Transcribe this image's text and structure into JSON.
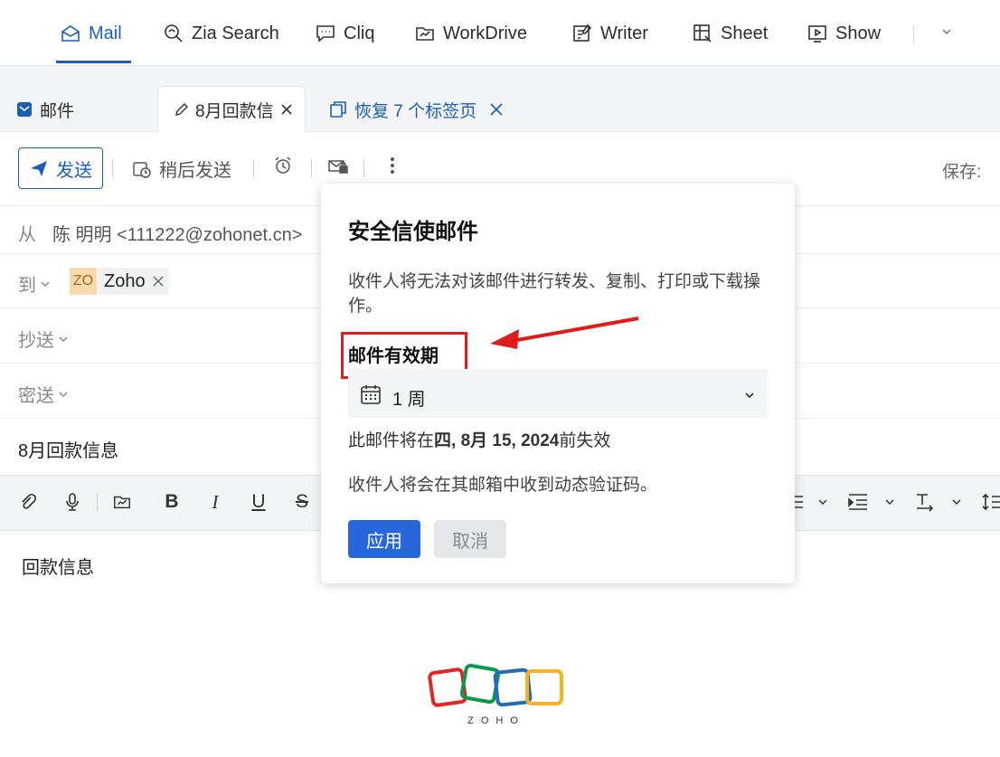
{
  "apps": [
    {
      "label": "Mail",
      "icon": "mail-icon"
    },
    {
      "label": "Zia Search",
      "icon": "zia-search-icon"
    },
    {
      "label": "Cliq",
      "icon": "chat-icon"
    },
    {
      "label": "WorkDrive",
      "icon": "folder-icon"
    },
    {
      "label": "Writer",
      "icon": "writer-icon"
    },
    {
      "label": "Sheet",
      "icon": "sheet-icon"
    },
    {
      "label": "Show",
      "icon": "show-icon"
    }
  ],
  "tabs": {
    "mail": "邮件",
    "draft": "8月回款信",
    "restore": "恢复 7 个标签页"
  },
  "toolbar": {
    "send": "发送",
    "send_later": "稍后发送",
    "save_label": "保存:"
  },
  "compose": {
    "from_label": "从",
    "from_value": "陈 明明 <111222@zohonet.cn>",
    "to_label": "到",
    "recipient_avatar": "ZO",
    "recipient_name": "Zoho",
    "cc_label": "抄送",
    "bcc_label": "密送",
    "subject": "8月回款信息",
    "body": "回款信息",
    "logo_text": "ZOHO"
  },
  "popup": {
    "title": "安全信使邮件",
    "description": "收件人将无法对该邮件进行转发、复制、打印或下载操作。",
    "expiry_label": "邮件有效期",
    "expiry_value": "1 周",
    "expiry_prefix": "此邮件将在",
    "expiry_date": "四, 8月 15, 2024",
    "expiry_suffix": "前失效",
    "otp_note": "收件人将会在其邮箱中收到动态验证码。",
    "apply": "应用",
    "cancel": "取消"
  },
  "colors": {
    "accent": "#1a5fb4",
    "apply_button": "#2767d9",
    "annotation": "#e01b1b"
  }
}
